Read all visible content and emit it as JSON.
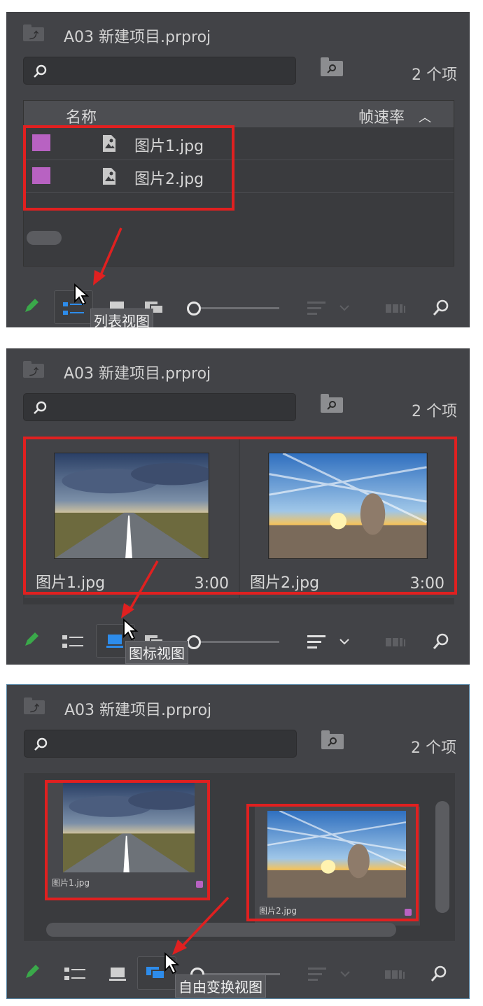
{
  "panel_title": "A03 新建项目.prproj",
  "item_count": "2 个项",
  "columns": {
    "name": "名称",
    "frame_rate": "帧速率"
  },
  "files": [
    {
      "name": "图片1.jpg",
      "duration": "3:00",
      "fv_label": "图片1.jpg",
      "label_color": "#b862c2"
    },
    {
      "name": "图片2.jpg",
      "duration": "3:00",
      "fv_label": "图片2.jpg",
      "label_color": "#b862c2"
    }
  ],
  "tooltips": {
    "list_view": "列表视图",
    "icon_view": "图标视图",
    "freeform_view": "自由变换视图"
  },
  "icons": [
    "folder-up-icon",
    "search-icon",
    "new-bin-icon",
    "pencil-icon",
    "list-view-icon",
    "icon-view-icon",
    "freeform-view-icon",
    "zoom-slider",
    "sort-icon",
    "chevron-down-icon",
    "automate-sequence-icon",
    "find-icon"
  ],
  "colors": {
    "panel_bg": "#424347",
    "accent_blue": "#2d8ceb",
    "highlight_red": "#e02020",
    "label_violet": "#b862c2",
    "pencil_green": "#3aa94a"
  }
}
